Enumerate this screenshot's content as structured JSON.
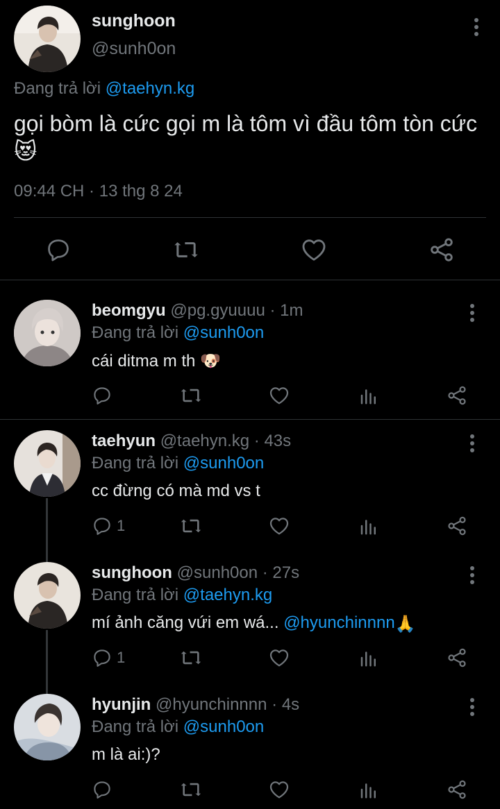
{
  "colors": {
    "background": "#000000",
    "text": "#e7e9ea",
    "muted": "#71767b",
    "link": "#1d9bf0"
  },
  "main_tweet": {
    "name": "sunghoon",
    "handle": "@sunh0on",
    "replying_prefix": "Đang trả lời",
    "replying_to": "@taehyn.kg",
    "text": "gọi bòm là cức gọi m là tôm vì đầu tôm tòn cức😻",
    "meta": "09:44 CH · 13 thg 8 24",
    "icons": [
      "reply-icon",
      "retweet-icon",
      "like-icon",
      "share-icon"
    ]
  },
  "replies": [
    {
      "name": "beomgyu",
      "handle": "@pg.gyuuuu",
      "time": "· 1m",
      "replying_prefix": "Đang trả lời",
      "replying_to": "@sunh0on",
      "text": "cái ditma m th 🐶",
      "text_plain": "cái ditma m th",
      "emoji": "🐶",
      "reply_count": ""
    },
    {
      "name": "taehyun",
      "handle": "@taehyn.kg",
      "time": "· 43s",
      "replying_prefix": "Đang trả lời",
      "replying_to": "@sunh0on",
      "text": "cc đừng có mà md vs t",
      "reply_count": "1"
    },
    {
      "name": "sunghoon",
      "handle": "@sunh0on",
      "time": "· 27s",
      "replying_prefix": "Đang trả lời",
      "replying_to": "@taehyn.kg",
      "text_plain": "mí ảnh căng vứi em wá...",
      "mention": "@hyunchinnnn",
      "emoji": "🙏",
      "reply_count": "1"
    },
    {
      "name": "hyunjin",
      "handle": "@hyunchinnnn",
      "time": "· 4s",
      "replying_prefix": "Đang trả lời",
      "replying_to": "@sunh0on",
      "text": "m là ai:)?",
      "reply_count": ""
    }
  ]
}
